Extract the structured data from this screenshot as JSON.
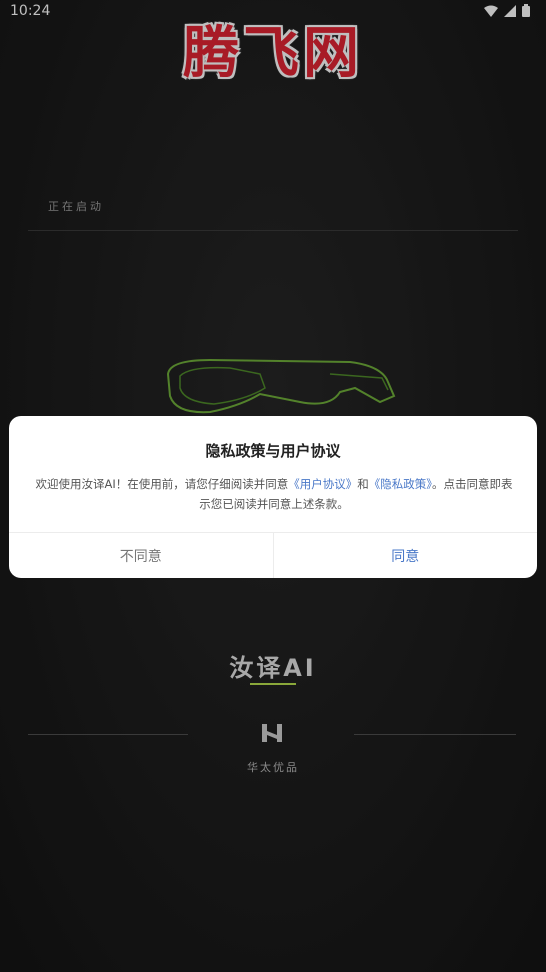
{
  "statusbar": {
    "time": "10:24",
    "icons": [
      "wifi-icon",
      "signal-icon",
      "battery-icon"
    ]
  },
  "watermark": {
    "text": "腾飞网",
    "color": "#e02433"
  },
  "splash": {
    "starting_text": "正在启动",
    "brand_name": "汝译AI",
    "company_name": "华太优品",
    "accent_color": "#8aa83a"
  },
  "dialog": {
    "title": "隐私政策与用户协议",
    "body_prefix": "欢迎使用汝译AI！在使用前，请您仔细阅读并同意",
    "user_agreement_link": "《用户协议》",
    "conjunction": "和",
    "privacy_policy_link": "《隐私政策》",
    "body_suffix": "。点击同意即表示您已阅读并同意上述条款。",
    "disagree_label": "不同意",
    "agree_label": "同意",
    "link_color": "#4a78c8"
  }
}
